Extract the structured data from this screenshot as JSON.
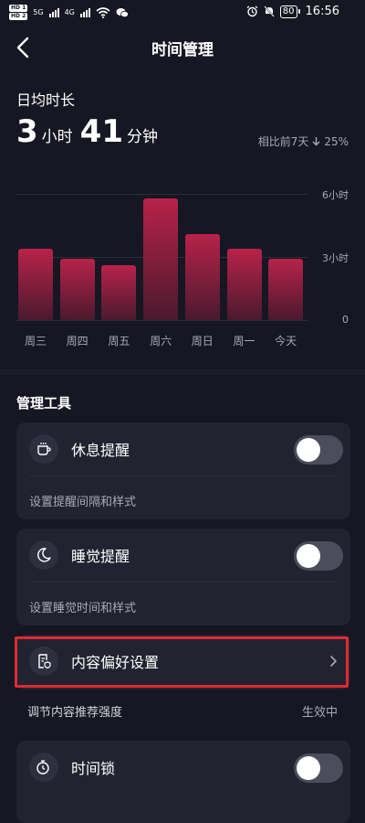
{
  "status_bar": {
    "sim1": "HD 1",
    "sim2": "HD 2",
    "net1": "5G",
    "net2": "4G",
    "battery": "80",
    "time": "16:56"
  },
  "header": {
    "title": "时间管理",
    "back_icon": "chevron-left-icon"
  },
  "daily": {
    "label": "日均时长",
    "hours": "3",
    "hours_unit": "小时",
    "minutes": "41",
    "minutes_unit": "分钟",
    "compare_text": "相比前7天",
    "compare_value": "25%",
    "compare_direction": "down"
  },
  "chart_data": {
    "type": "bar",
    "categories": [
      "周三",
      "周四",
      "周五",
      "周六",
      "周日",
      "周一",
      "今天"
    ],
    "values": [
      3.4,
      2.9,
      2.6,
      5.8,
      4.1,
      3.4,
      2.9
    ],
    "ytick_labels": [
      "6小时",
      "3小时",
      "0"
    ],
    "ylim": [
      0,
      6
    ],
    "grid": true,
    "color": "#b8224a"
  },
  "tools": {
    "section_title": "管理工具",
    "rest": {
      "label": "休息提醒",
      "sub": "设置提醒间隔和样式",
      "enabled": false,
      "icon": "cup-icon"
    },
    "sleep": {
      "label": "睡觉提醒",
      "sub": "设置睡觉时间和样式",
      "enabled": false,
      "icon": "moon-icon"
    },
    "preference": {
      "label": "内容偏好设置",
      "sub": "调节内容推荐强度",
      "status": "生效中",
      "icon": "document-shield-icon"
    },
    "lock": {
      "label": "时间锁",
      "enabled": false,
      "icon": "timer-lock-icon"
    }
  },
  "colors": {
    "background": "#161722",
    "card": "#222330",
    "highlight": "#e02a31"
  }
}
